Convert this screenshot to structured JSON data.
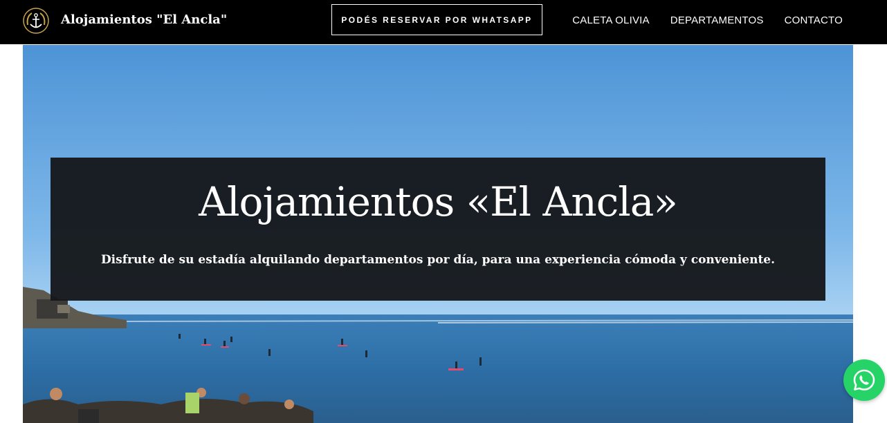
{
  "header": {
    "logo_icon": "anchor-emblem-icon",
    "site_title": "Alojamientos \"El Ancla\"",
    "cta_label": "PODÉS RESERVAR POR WHATSAPP",
    "nav": [
      {
        "label": "CALETA OLIVIA"
      },
      {
        "label": "DEPARTAMENTOS"
      },
      {
        "label": "CONTACTO"
      }
    ]
  },
  "hero": {
    "title": "Alojamientos «El Ancla»",
    "subtitle": "Disfrute de su estadía alquilando departamentos por día, para una experiencia cómoda y conveniente."
  },
  "whatsapp": {
    "icon": "whatsapp-icon",
    "color": "#25d366"
  },
  "colors": {
    "header_bg": "#000000",
    "overlay_bg": "#141619"
  }
}
